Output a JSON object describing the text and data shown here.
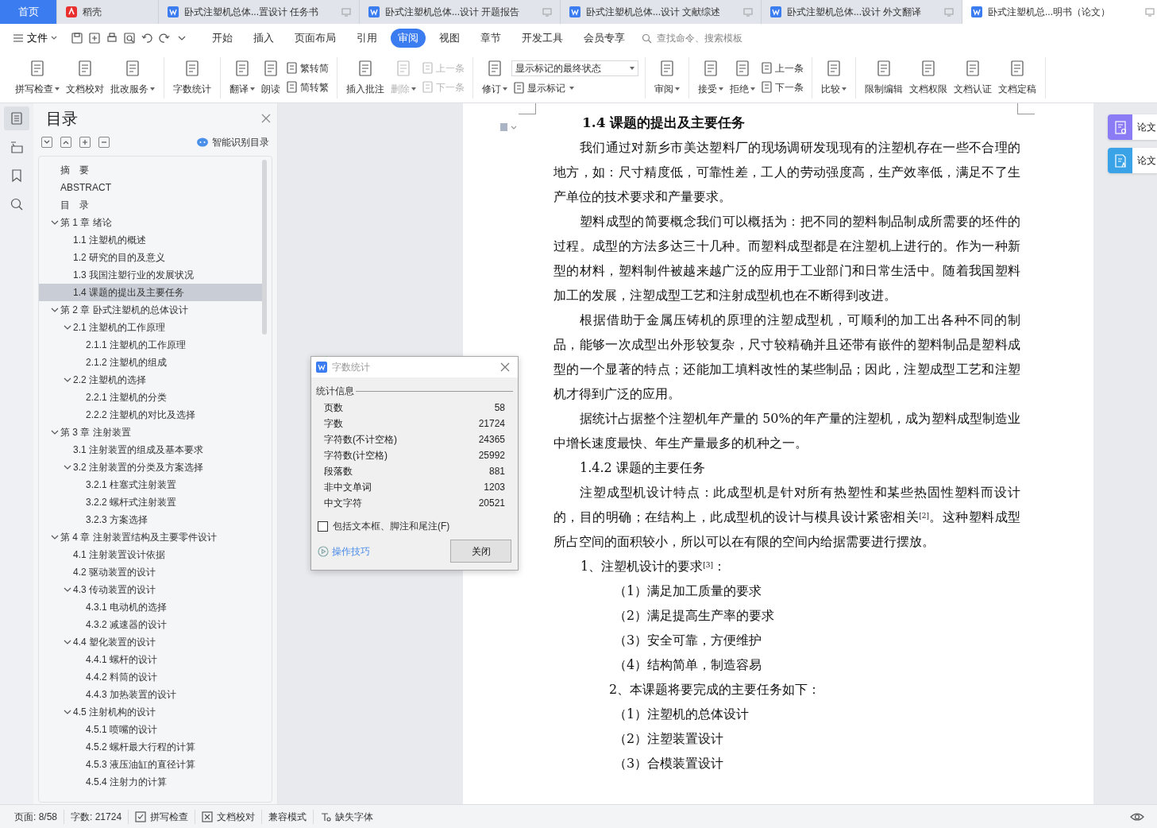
{
  "doc_tabs": [
    {
      "kind": "home",
      "label": "首页",
      "selected": false
    },
    {
      "kind": "docer",
      "label": "稻壳",
      "selected": false
    },
    {
      "kind": "doc",
      "label": "卧式注塑机总体...置设计 任务书",
      "selected": false
    },
    {
      "kind": "doc",
      "label": "卧式注塑机总体...设计 开题报告",
      "selected": false
    },
    {
      "kind": "doc",
      "label": "卧式注塑机总体...设计 文献综述",
      "selected": false
    },
    {
      "kind": "doc",
      "label": "卧式注塑机总体...设计 外文翻译",
      "selected": false
    },
    {
      "kind": "doc",
      "label": "卧式注塑机总...明书（论文）",
      "selected": true
    }
  ],
  "menu": {
    "file_label": "文件",
    "tabs": [
      {
        "label": "开始",
        "selected": false
      },
      {
        "label": "插入",
        "selected": false
      },
      {
        "label": "页面布局",
        "selected": false
      },
      {
        "label": "引用",
        "selected": false
      },
      {
        "label": "审阅",
        "selected": true
      },
      {
        "label": "视图",
        "selected": false
      },
      {
        "label": "章节",
        "selected": false
      },
      {
        "label": "开发工具",
        "selected": false
      },
      {
        "label": "会员专享",
        "selected": false
      }
    ],
    "search": {
      "placeholder": "查找命令、搜索模板"
    }
  },
  "ribbon": [
    {
      "items": [
        {
          "kind": "large",
          "label": "拼写检查",
          "caret": true,
          "disabled": false
        },
        {
          "kind": "large",
          "label": "文档校对",
          "caret": false,
          "disabled": false
        },
        {
          "kind": "large",
          "label": "批改服务",
          "caret": true,
          "disabled": false
        }
      ]
    },
    {
      "items": [
        {
          "kind": "large",
          "label": "字数统计",
          "caret": false,
          "disabled": false
        }
      ]
    },
    {
      "items": [
        {
          "kind": "large",
          "label": "翻译",
          "caret": true,
          "disabled": false
        },
        {
          "kind": "large",
          "label": "朗读",
          "caret": false,
          "disabled": false
        },
        {
          "kind": "stack",
          "rows": [
            {
              "kind": "button",
              "label": "繁转简",
              "disabled": false,
              "caret": false
            },
            {
              "kind": "button",
              "label": "简转繁",
              "disabled": false,
              "caret": false
            }
          ]
        }
      ]
    },
    {
      "items": [
        {
          "kind": "large",
          "label": "插入批注",
          "caret": false,
          "disabled": false
        },
        {
          "kind": "large",
          "label": "删除",
          "caret": true,
          "disabled": true
        },
        {
          "kind": "stack",
          "rows": [
            {
              "kind": "button",
              "label": "上一条",
              "disabled": true,
              "caret": false
            },
            {
              "kind": "button",
              "label": "下一条",
              "disabled": true,
              "caret": false
            }
          ]
        }
      ]
    },
    {
      "items": [
        {
          "kind": "large",
          "label": "修订",
          "caret": true,
          "disabled": false
        },
        {
          "kind": "stack",
          "rows": [
            {
              "kind": "select",
              "label": "显示标记的最终状态",
              "disabled": false,
              "caret": true
            },
            {
              "kind": "button",
              "label": "显示标记",
              "disabled": false,
              "caret": true
            }
          ]
        }
      ]
    },
    {
      "items": [
        {
          "kind": "large",
          "label": "审阅",
          "caret": true,
          "disabled": false
        }
      ]
    },
    {
      "items": [
        {
          "kind": "large",
          "label": "接受",
          "caret": true,
          "disabled": false
        },
        {
          "kind": "large",
          "label": "拒绝",
          "caret": true,
          "disabled": false
        },
        {
          "kind": "stack",
          "rows": [
            {
              "kind": "button",
              "label": "上一条",
              "disabled": false,
              "caret": false
            },
            {
              "kind": "button",
              "label": "下一条",
              "disabled": false,
              "caret": false
            }
          ]
        }
      ]
    },
    {
      "items": [
        {
          "kind": "large",
          "label": "比较",
          "caret": true,
          "disabled": false
        }
      ]
    },
    {
      "items": [
        {
          "kind": "large",
          "label": "限制编辑",
          "caret": false,
          "disabled": false
        },
        {
          "kind": "large",
          "label": "文档权限",
          "caret": false,
          "disabled": false
        },
        {
          "kind": "large",
          "label": "文档认证",
          "caret": false,
          "disabled": false
        },
        {
          "kind": "large",
          "label": "文档定稿",
          "caret": false,
          "disabled": false
        }
      ]
    }
  ],
  "rail": [
    {
      "selected": true
    },
    {
      "selected": false
    },
    {
      "selected": false
    },
    {
      "selected": false
    }
  ],
  "toc": {
    "title": "目录",
    "smart_button": "智能识别目录",
    "items": [
      {
        "label": "摘　要",
        "selected": false
      },
      {
        "label": "ABSTRACT",
        "selected": false
      },
      {
        "label": "目　录",
        "selected": false
      },
      {
        "label": "第 1 章  绪论",
        "selected": false,
        "expanded": true,
        "children": [
          {
            "label": "1.1  注塑机的概述",
            "selected": false
          },
          {
            "label": "1.2  研究的目的及意义",
            "selected": false
          },
          {
            "label": "1.3  我国注塑行业的发展状况",
            "selected": false
          },
          {
            "label": "1.4  课题的提出及主要任务",
            "selected": true
          }
        ]
      },
      {
        "label": "第 2 章  卧式注塑机的总体设计",
        "selected": false,
        "expanded": true,
        "children": [
          {
            "label": "2.1 注塑机的工作原理",
            "selected": false,
            "expanded": true,
            "children": [
              {
                "label": "2.1.1 注塑机的工作原理",
                "selected": false
              },
              {
                "label": "2.1.2 注塑机的组成",
                "selected": false
              }
            ]
          },
          {
            "label": "2.2  注塑机的选择",
            "selected": false,
            "expanded": true,
            "children": [
              {
                "label": "2.2.1 注塑机的分类",
                "selected": false
              },
              {
                "label": "2.2.2 注塑机的对比及选择",
                "selected": false
              }
            ]
          }
        ]
      },
      {
        "label": "第 3 章  注射装置",
        "selected": false,
        "expanded": true,
        "children": [
          {
            "label": "3.1  注射装置的组成及基本要求",
            "selected": false
          },
          {
            "label": "3.2  注射装置的分类及方案选择",
            "selected": false,
            "expanded": true,
            "children": [
              {
                "label": "3.2.1 柱塞式注射装置",
                "selected": false
              },
              {
                "label": "3.2.2 螺杆式注射装置",
                "selected": false
              },
              {
                "label": "3.2.3  方案选择",
                "selected": false
              }
            ]
          }
        ]
      },
      {
        "label": "第 4 章  注射装置结构及主要零件设计",
        "selected": false,
        "expanded": true,
        "children": [
          {
            "label": "4.1 注射装置设计依据",
            "selected": false
          },
          {
            "label": "4.2 驱动装置的设计",
            "selected": false
          },
          {
            "label": "4.3 传动装置的设计",
            "selected": false,
            "expanded": true,
            "children": [
              {
                "label": "4.3.1 电动机的选择",
                "selected": false
              },
              {
                "label": "4.3.2 减速器的设计",
                "selected": false
              }
            ]
          },
          {
            "label": "4.4 塑化装置的设计",
            "selected": false,
            "expanded": true,
            "children": [
              {
                "label": "4.4.1 螺杆的设计",
                "selected": false
              },
              {
                "label": "4.4.2 料筒的设计",
                "selected": false
              },
              {
                "label": "4.4.3 加热装置的设计",
                "selected": false
              }
            ]
          },
          {
            "label": "4.5 注射机构的设计",
            "selected": false,
            "expanded": true,
            "children": [
              {
                "label": "4.5.1 喷嘴的设计",
                "selected": false
              },
              {
                "label": "4.5.2 螺杆最大行程的计算",
                "selected": false
              },
              {
                "label": "4.5.3 液压油缸的直径计算",
                "selected": false
              },
              {
                "label": "4.5.4 注射力的计算",
                "selected": false
              }
            ]
          }
        ]
      }
    ]
  },
  "document": {
    "heading": "1.4 课题的提出及主要任务",
    "paragraphs": [
      {
        "kind": "body",
        "text": "我们通过对新乡市美达塑料厂的现场调研发现现有的注塑机存在一些不合理的地方，如：尺寸精度低，可靠性差，工人的劳动强度高，生产效率低，满足不了生产单位的技术要求和产量要求。"
      },
      {
        "kind": "body",
        "text": "塑料成型的简要概念我们可以概括为：把不同的塑料制品制成所需要的坯件的过程。成型的方法多达三十几种。而塑料成型都是在注塑机上进行的。作为一种新型的材料，塑料制件被越来越广泛的应用于工业部门和日常生活中。随着我国塑料加工的发展，注塑成型工艺和注射成型机也在不断得到改进。"
      },
      {
        "kind": "body",
        "text": "根据借助于金属压铸机的原理的注塑成型机，可顺利的加工出各种不同的制品，能够一次成型出外形较复杂，尺寸较精确并且还带有嵌件的塑料制品是塑料成型的一个显著的特点；还能加工填料改性的某些制品；因此，注塑成型工艺和注塑机才得到广泛的应用。"
      },
      {
        "kind": "body",
        "text": "据统计占据整个注塑机年产量的 50%的年产量的注塑机，成为塑料成型制造业中增长速度最快、年生产量最多的机种之一。"
      },
      {
        "kind": "body",
        "text": "1.4.2 课题的主要任务"
      },
      {
        "kind": "body",
        "text": "注塑成型机设计特点：此成型机是针对所有热塑性和某些热固性塑料而设计的，目的明确；在结构上，此成型机的设计与模具设计紧密相关$^{[2]}$。这种塑料成型所占空间的面积较小，所以可以在有限的空间内给据需要进行摆放。"
      },
      {
        "kind": "list",
        "text": "1、注塑机设计的要求$^{[3]}$："
      },
      {
        "kind": "item",
        "text": "（1）满足加工质量的要求"
      },
      {
        "kind": "item",
        "text": "（2）满足提高生产率的要求"
      },
      {
        "kind": "item",
        "text": "（3）安全可靠，方便维护"
      },
      {
        "kind": "item",
        "text": "（4）结构简单，制造容易"
      },
      {
        "kind": "list2",
        "text": "2、本课题将要完成的主要任务如下："
      },
      {
        "kind": "item",
        "text": "（1）注塑机的总体设计"
      },
      {
        "kind": "item",
        "text": "（2）注塑装置设计"
      },
      {
        "kind": "item",
        "text": "（3）合模装置设计"
      }
    ]
  },
  "dialog": {
    "title": "字数统计",
    "section": "统计信息",
    "rows": [
      {
        "label": "页数",
        "value": "58"
      },
      {
        "label": "字数",
        "value": "21724"
      },
      {
        "label": "字符数(不计空格)",
        "value": "24365"
      },
      {
        "label": "字符数(计空格)",
        "value": "25992"
      },
      {
        "label": "段落数",
        "value": "881"
      },
      {
        "label": "非中文单词",
        "value": "1203"
      },
      {
        "label": "中文字符",
        "value": "20521"
      }
    ],
    "checkbox": {
      "label": "包括文本框、脚注和尾注(F)",
      "checked": false
    },
    "tips_link": "操作技巧",
    "close_button": "关闭"
  },
  "side_cards": [
    {
      "label": "论文",
      "color": "#8b7cf6"
    },
    {
      "label": "论文",
      "color": "#3aa3e8"
    }
  ],
  "status_bar": [
    {
      "kind": "text",
      "label": "页面: 8/58"
    },
    {
      "kind": "text",
      "label": "字数: 21724"
    },
    {
      "kind": "check",
      "label": "拼写检查"
    },
    {
      "kind": "proof",
      "label": "文档校对"
    },
    {
      "kind": "text",
      "label": "兼容模式"
    },
    {
      "kind": "font",
      "label": "缺失字体"
    }
  ]
}
